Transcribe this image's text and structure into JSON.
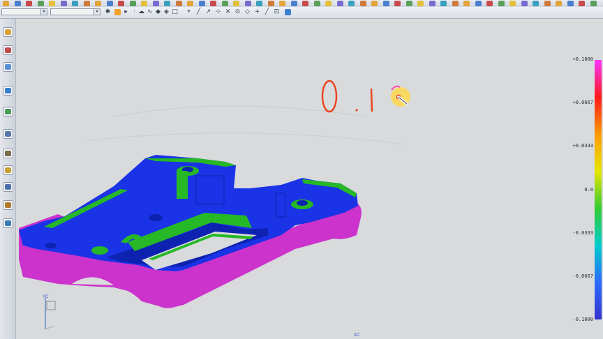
{
  "toolbar": {
    "filter_selector": {
      "value": "",
      "arrow": "▾"
    },
    "type_selector": {
      "value": "",
      "arrow": "▾"
    }
  },
  "left_toolbar": {
    "items": [
      {
        "name": "part-navigator-icon",
        "color": "#d9a23a"
      },
      {
        "name": "assembly-navigator-icon",
        "color": "#c24a4a"
      },
      {
        "name": "roles-icon",
        "color": "#5a8ed6"
      },
      {
        "name": "web-browser-icon",
        "color": "#3a7fd0"
      },
      {
        "name": "history-icon",
        "color": "#4a9a5a"
      },
      {
        "name": "clock-icon",
        "color": "#5577aa"
      },
      {
        "name": "reuse-library-icon",
        "color": "#7a6a4a"
      },
      {
        "name": "hd3d-tools-icon",
        "color": "#c8a030"
      },
      {
        "name": "process-studio-icon",
        "color": "#4a6fa8"
      },
      {
        "name": "manufacturing-wizards-icon",
        "color": "#b07a2a"
      },
      {
        "name": "system-materials-icon",
        "color": "#3a7ab0"
      }
    ]
  },
  "annotation": {
    "handwritten_text": "0.1",
    "stroke_color": "#e8461f"
  },
  "legend": {
    "labels": [
      "+0.1000",
      "+0.0667",
      "+0.0333",
      "0.0",
      "-0.0333",
      "-0.0667",
      "-0.1000"
    ],
    "gradient": [
      "#ff33ff",
      "#ff1a1a",
      "#ff9900",
      "#e6e600",
      "#33cc33",
      "#00cccc",
      "#2a6aff",
      "#3333cc"
    ]
  },
  "model": {
    "colors": {
      "blue": "#1a33e6",
      "magenta": "#cc33cc",
      "green": "#26b826",
      "dark_blue": "#0d22b0"
    }
  },
  "triad": {
    "label_x": "XC",
    "label_y": "YC"
  }
}
